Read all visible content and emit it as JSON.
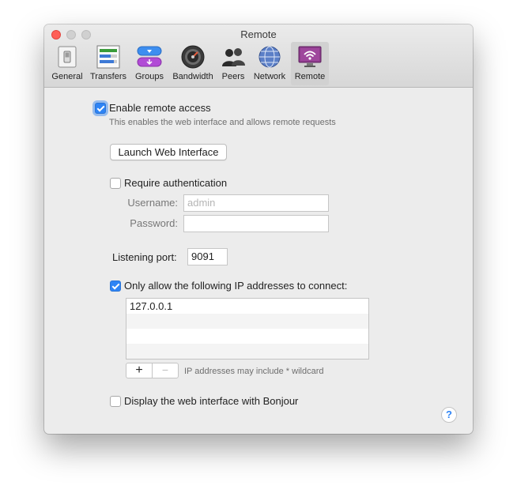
{
  "window": {
    "title": "Remote"
  },
  "toolbar": {
    "items": [
      {
        "label": "General",
        "icon": "general-switch-icon"
      },
      {
        "label": "Transfers",
        "icon": "transfers-icon"
      },
      {
        "label": "Groups",
        "icon": "groups-icon"
      },
      {
        "label": "Bandwidth",
        "icon": "bandwidth-gauge-icon"
      },
      {
        "label": "Peers",
        "icon": "peers-people-icon"
      },
      {
        "label": "Network",
        "icon": "network-globe-icon"
      },
      {
        "label": "Remote",
        "icon": "remote-wifi-monitor-icon",
        "selected": true
      }
    ]
  },
  "remote": {
    "enable_label": "Enable remote access",
    "enable_checked": true,
    "enable_description": "This enables the web interface and allows remote requests",
    "launch_button": "Launch Web Interface",
    "require_auth_label": "Require authentication",
    "require_auth_checked": false,
    "username_label": "Username:",
    "username_placeholder": "admin",
    "password_label": "Password:",
    "port_label": "Listening port:",
    "port_value": "9091",
    "ip_only_label": "Only allow the following IP addresses to connect:",
    "ip_only_checked": true,
    "ip_addresses": [
      "127.0.0.1"
    ],
    "add_symbol": "+",
    "remove_symbol": "−",
    "ip_hint": "IP addresses may include * wildcard",
    "bonjour_label": "Display the web interface with Bonjour",
    "bonjour_checked": false,
    "help_symbol": "?"
  },
  "colors": {
    "accent": "#2e84f5",
    "close": "#ff5f57",
    "remote_icon": "#8e3a8c"
  }
}
